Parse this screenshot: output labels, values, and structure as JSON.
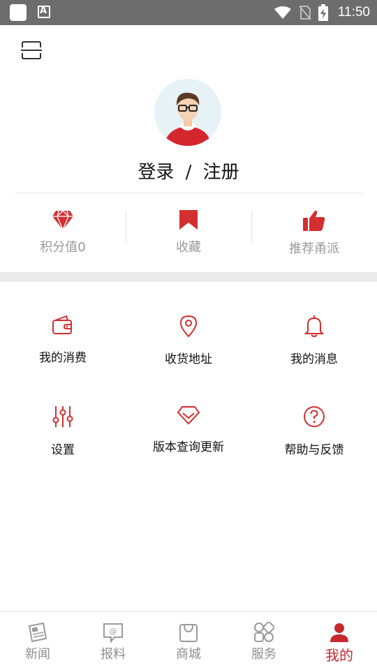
{
  "status_bar": {
    "time": "11:50"
  },
  "colors": {
    "accent": "#d32f2f",
    "muted": "#9a9a9a",
    "band": "#eaeaea"
  },
  "header": {
    "menu_icon": "menu-icon"
  },
  "profile": {
    "avatar_icon": "user-avatar",
    "login_label": "登录",
    "separator": "/",
    "register_label": "注册"
  },
  "stats": [
    {
      "label": "积分值0",
      "icon": "diamond-icon"
    },
    {
      "label": "收藏",
      "icon": "bookmark-icon"
    },
    {
      "label": "推荐甬派",
      "icon": "thumbs-up-icon"
    }
  ],
  "grid": [
    {
      "label": "我的消费",
      "icon": "wallet-icon"
    },
    {
      "label": "收货地址",
      "icon": "location-pin-icon"
    },
    {
      "label": "我的消息",
      "icon": "bell-icon"
    },
    {
      "label": "设置",
      "icon": "sliders-icon"
    },
    {
      "label": "版本查询更新",
      "icon": "diamond-outline-icon"
    },
    {
      "label": "帮助与反馈",
      "icon": "help-icon"
    }
  ],
  "bottom_nav": [
    {
      "label": "新闻",
      "icon": "newspaper-icon",
      "active": false
    },
    {
      "label": "报料",
      "icon": "report-icon",
      "active": false
    },
    {
      "label": "商城",
      "icon": "shopping-bag-icon",
      "active": false
    },
    {
      "label": "服务",
      "icon": "services-icon",
      "active": false
    },
    {
      "label": "我的",
      "icon": "profile-icon",
      "active": true
    }
  ]
}
